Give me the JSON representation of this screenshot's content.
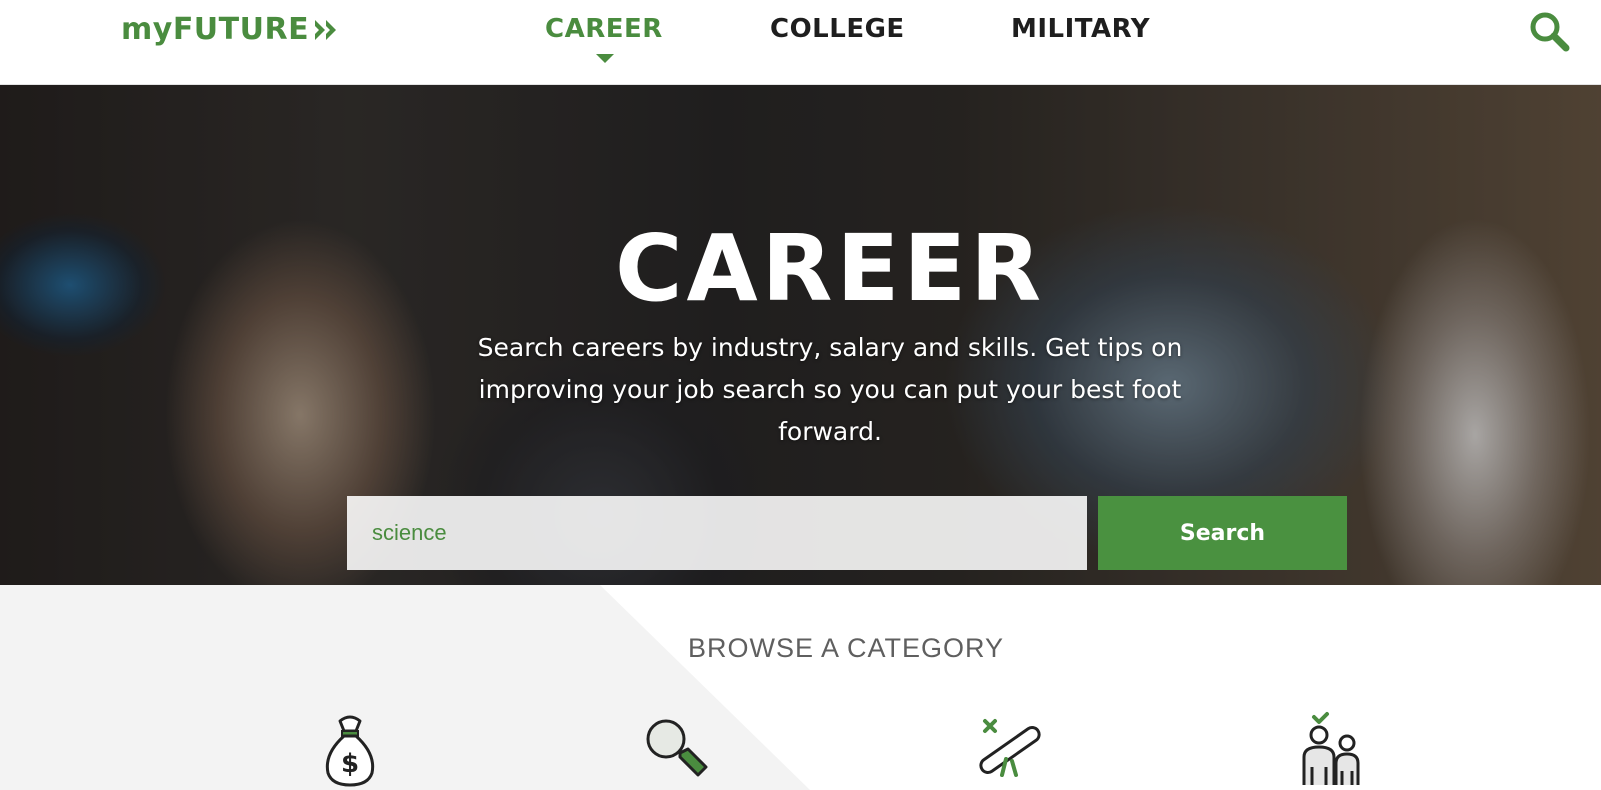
{
  "header": {
    "logo_text": "myFUTURE",
    "nav": [
      {
        "label": "CAREER",
        "active": true
      },
      {
        "label": "COLLEGE",
        "active": false
      },
      {
        "label": "MILITARY",
        "active": false
      }
    ],
    "search_icon": "search-icon"
  },
  "hero": {
    "title": "CAREER",
    "subtitle": "Search careers by industry, salary and skills. Get tips on improving your job search so you can put your best foot forward.",
    "search_value": "science",
    "search_button": "Search"
  },
  "browse": {
    "heading": "BROWSE A CATEGORY",
    "categories": [
      {
        "icon": "money-bag-icon"
      },
      {
        "icon": "magnifying-glass-icon"
      },
      {
        "icon": "diploma-icon"
      },
      {
        "icon": "people-icon"
      }
    ]
  },
  "colors": {
    "brand_green": "#4a8c3f",
    "button_green": "#4a9140",
    "nav_text": "#1e1e1e"
  }
}
